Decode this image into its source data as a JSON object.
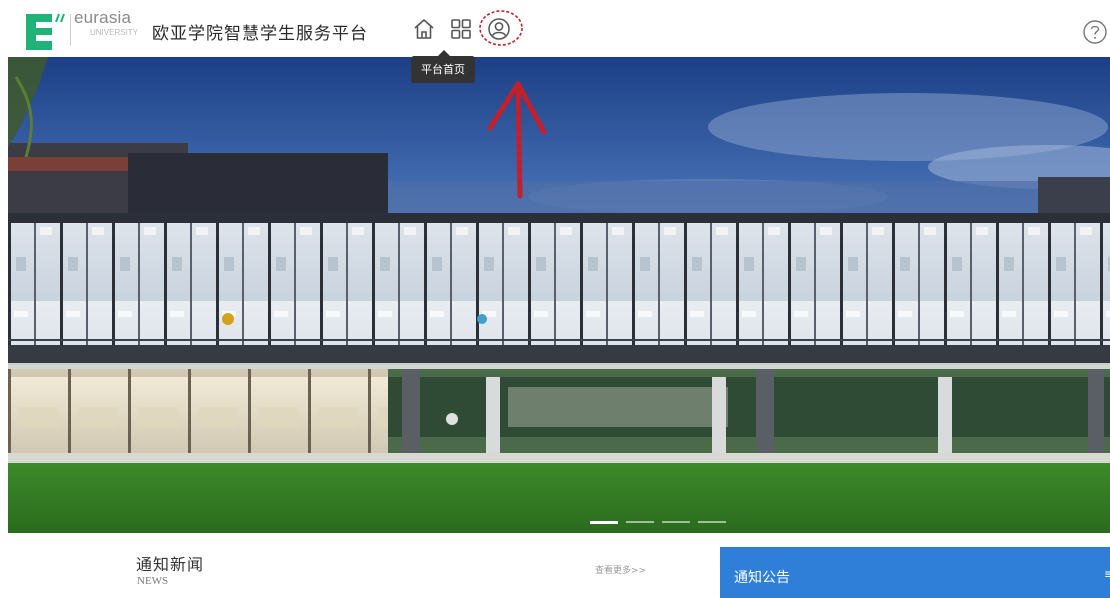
{
  "header": {
    "logo_text": "eurasia",
    "logo_subtext": "UNIVERSITY",
    "platform_title": "欧亚学院智慧学生服务平台",
    "nav_icons": [
      "home-icon",
      "apps-grid-icon",
      "user-icon"
    ],
    "help_icon": "help-icon",
    "tooltip": "平台首页"
  },
  "banner": {
    "slide_count": 4,
    "active_slide": 1
  },
  "news": {
    "title": "通知新闻",
    "subtitle": "NEWS",
    "more_link": "查看更多>>"
  },
  "notice": {
    "title": "通知公告",
    "more_link": "≡"
  },
  "colors": {
    "accent_blue": "#2f7fd9",
    "logo_green": "#21b27a",
    "annotation_red": "#c4202b",
    "tooltip_bg": "#333333"
  }
}
